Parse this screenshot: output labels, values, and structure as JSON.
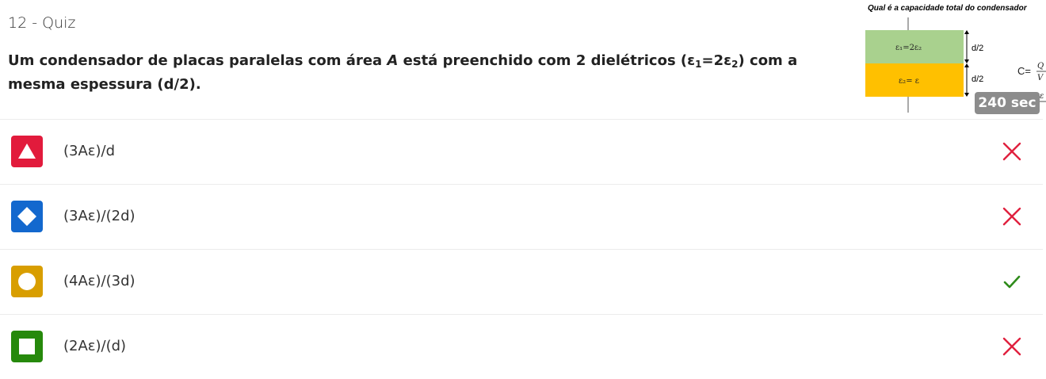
{
  "header": {
    "quiz_label": "12 - Quiz",
    "question_parts": {
      "p1": "Um condensador de placas paralelas com área ",
      "p2": "A",
      "p3": " está preenchido com 2 dielétricos (ε",
      "p4": "1",
      "p5": "=2ε",
      "p6": "2",
      "p7": ") com a mesma espessura (d/2)."
    }
  },
  "figure": {
    "title": "Qual é a capacidade total do condensador",
    "top_dielectric_label": "ε₁=2ε₂",
    "bottom_dielectric_label": "ε₂= ε",
    "top_dimension": "d/2",
    "bottom_dimension": "d/2",
    "formula_partial": "C=",
    "colors": {
      "top": "#a9d18e",
      "bottom": "#ffc000"
    }
  },
  "timer": {
    "label": "240 sec"
  },
  "options": [
    {
      "shape": "triangle-icon",
      "color": "#e21b3c",
      "text": "(3Aε)/d",
      "status": "incorrect"
    },
    {
      "shape": "diamond-icon",
      "color": "#1368ce",
      "text": "(3Aε)/(2d)",
      "status": "incorrect"
    },
    {
      "shape": "circle-icon",
      "color": "#d89e00",
      "text": "(4Aε)/(3d)",
      "status": "correct"
    },
    {
      "shape": "square-icon",
      "color": "#26890c",
      "text": "(2Aε)/(d)",
      "status": "incorrect"
    }
  ],
  "status_colors": {
    "correct": "#2e8b1a",
    "incorrect": "#e0213f"
  }
}
